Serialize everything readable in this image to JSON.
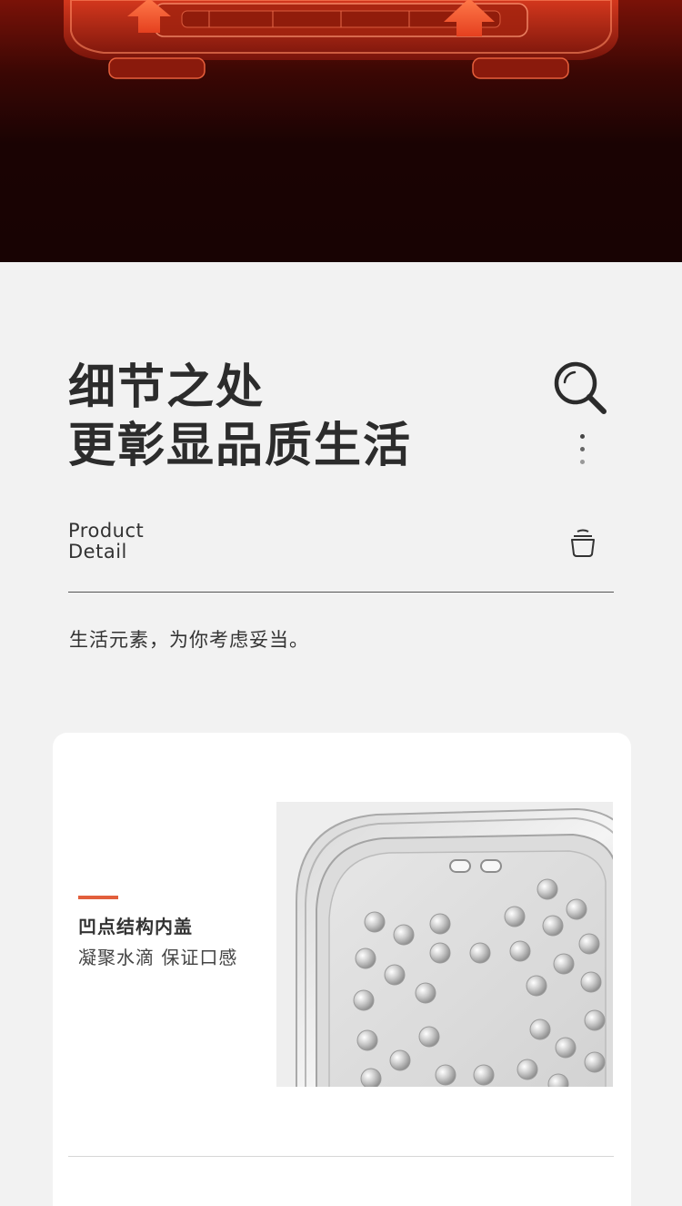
{
  "hero": {
    "image": "rice-cooker-heating-cutaway"
  },
  "headline": {
    "line1": "细节之处",
    "line2": "更彰显品质生活"
  },
  "section": {
    "label_line1": "Product",
    "label_line2": "Detail",
    "tagline": "生活元素，为你考虑妥当。"
  },
  "icons": {
    "search": "search-icon",
    "dots": "vertical-dots-icon",
    "bowl": "rice-bowl-icon"
  },
  "feature": {
    "title": "凹点结构内盖",
    "subtitle": "凝聚水滴  保证口感",
    "image": "dimpled-inner-lid-photo"
  },
  "colors": {
    "accent": "#e25f3c",
    "page_background": "#f2f2f2",
    "card_background": "#ffffff",
    "hero_dark": "#1a0303",
    "hero_red": "#c0301a"
  }
}
